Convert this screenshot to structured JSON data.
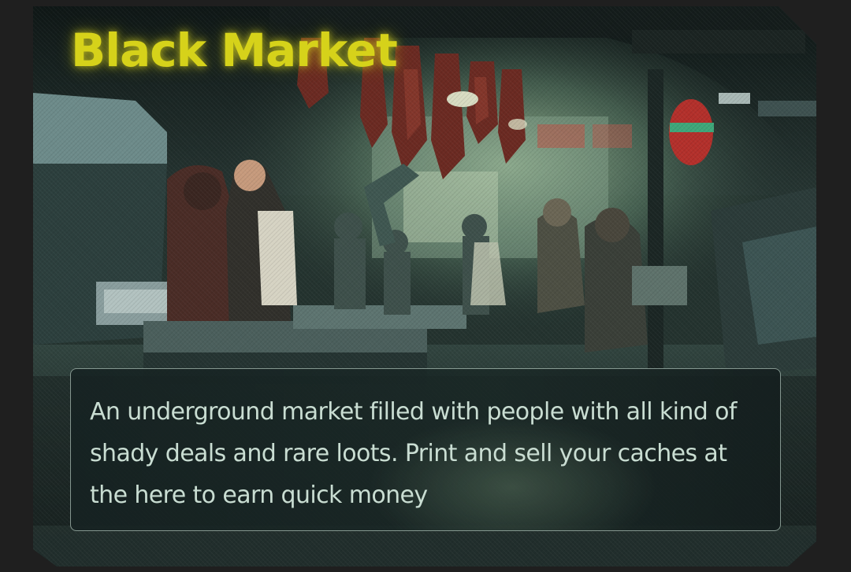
{
  "location": {
    "title": "Black Market",
    "description": "An underground market filled with people with all kind of shady deals and rare loots. Print and sell your caches at the here to earn quick money"
  },
  "illustration": {
    "subject": "underground market scene with vendors and crowd"
  },
  "colors": {
    "page_background": "#1f1f1f",
    "title": "#d6d21a",
    "description_text": "#c9ddd2",
    "box_border": "#aabeb4"
  }
}
